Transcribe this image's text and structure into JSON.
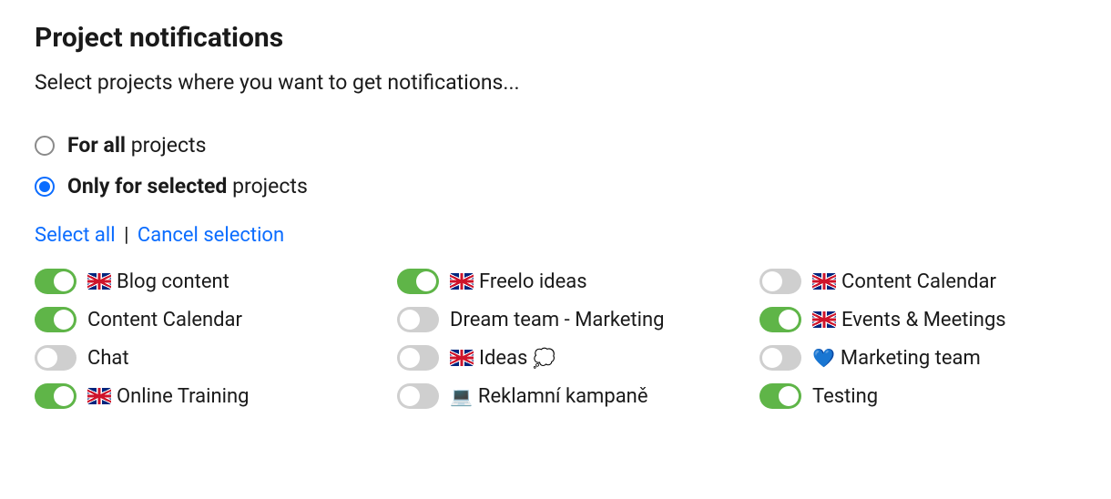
{
  "header": {
    "title": "Project notifications",
    "subtitle": "Select projects where you want to get notifications..."
  },
  "radios": {
    "all": {
      "bold": "For all",
      "rest": " projects",
      "checked": false
    },
    "selected": {
      "bold": "Only for selected",
      "rest": " projects",
      "checked": true
    }
  },
  "actions": {
    "select_all": "Select all",
    "separator": "|",
    "cancel": "Cancel selection"
  },
  "projects": [
    {
      "on": true,
      "icon": "flag-uk",
      "label": "Blog content"
    },
    {
      "on": true,
      "icon": "flag-uk",
      "label": "Freelo ideas"
    },
    {
      "on": false,
      "icon": "flag-uk",
      "label": "Content Calendar"
    },
    {
      "on": true,
      "icon": "",
      "label": "Content Calendar"
    },
    {
      "on": false,
      "icon": "",
      "label": "Dream team - Marketing"
    },
    {
      "on": true,
      "icon": "flag-uk",
      "label": "Events & Meetings"
    },
    {
      "on": false,
      "icon": "",
      "label": "Chat"
    },
    {
      "on": false,
      "icon": "flag-uk",
      "label": "Ideas",
      "trailing": "💭"
    },
    {
      "on": false,
      "icon": "heart",
      "label": "Marketing team"
    },
    {
      "on": true,
      "icon": "flag-uk",
      "label": "Online Training"
    },
    {
      "on": false,
      "icon": "laptop",
      "label": "Reklamní kampaně"
    },
    {
      "on": true,
      "icon": "",
      "label": "Testing"
    }
  ],
  "icons": {
    "heart": "💙",
    "laptop": "💻",
    "thought": "💭"
  }
}
